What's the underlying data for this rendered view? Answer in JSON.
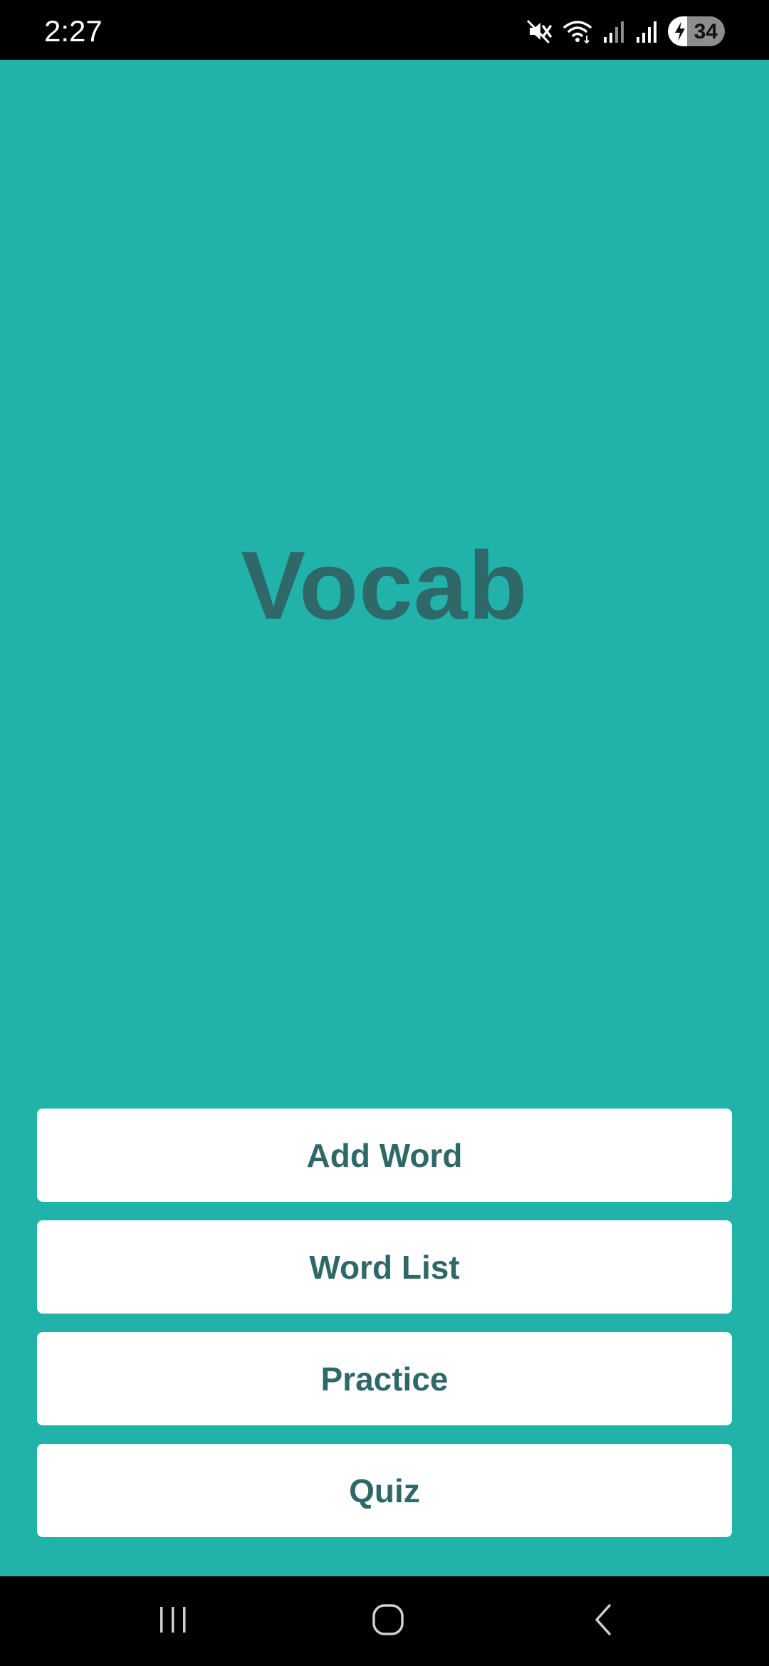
{
  "status_bar": {
    "time": "2:27",
    "battery_level": "34",
    "icons": [
      "mute-icon",
      "wifi-icon",
      "signal-icon-1",
      "signal-icon-2",
      "battery-charging-icon"
    ]
  },
  "app": {
    "title": "Vocab",
    "background_color": "#21b2aa",
    "accent_color": "#2f6869",
    "buttons": [
      {
        "label": "Add Word"
      },
      {
        "label": "Word List"
      },
      {
        "label": "Practice"
      },
      {
        "label": "Quiz"
      }
    ]
  },
  "nav_bar": {
    "icons": [
      "recent-apps-icon",
      "home-icon",
      "back-icon"
    ]
  }
}
